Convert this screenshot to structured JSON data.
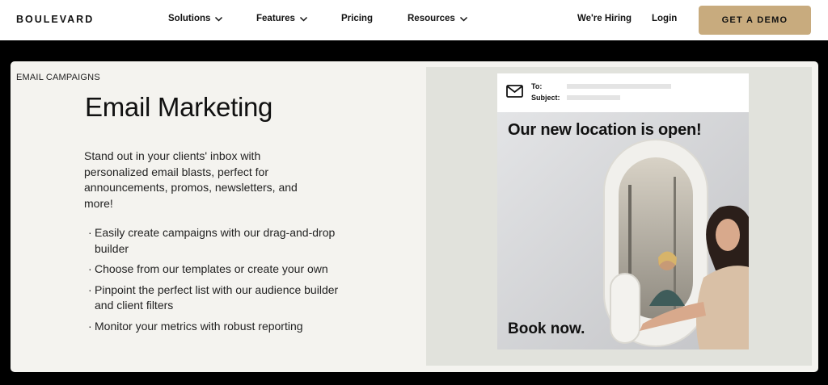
{
  "nav": {
    "logo": "BOULEVARD",
    "items": [
      {
        "label": "Solutions",
        "dropdown": true
      },
      {
        "label": "Features",
        "dropdown": true
      },
      {
        "label": "Pricing",
        "dropdown": false
      },
      {
        "label": "Resources",
        "dropdown": true
      }
    ],
    "hiring": "We're Hiring",
    "login": "Login",
    "demo_button": "GET A DEMO"
  },
  "section": {
    "eyebrow": "EMAIL CAMPAIGNS",
    "title": "Email Marketing",
    "description": "Stand out in your clients' inbox with personalized email blasts, perfect for announcements, promos, newsletters, and more!",
    "bullets": [
      "Easily create campaigns with our drag-and-drop builder",
      "Choose from our templates or create your own",
      "Pinpoint the perfect list with our audience builder and client filters",
      "Monitor your metrics with robust reporting"
    ]
  },
  "email_preview": {
    "to_label": "To:",
    "subject_label": "Subject:",
    "headline": "Our new location is open!",
    "cta": "Book now."
  },
  "colors": {
    "nav_bg": "#ffffff",
    "page_bg": "#000000",
    "card_bg": "#f4f3ef",
    "accent_button": "#c8ab7e",
    "preview_panel": "#e1e2dc"
  },
  "icons": {
    "chevron": "chevron-down-icon",
    "envelope": "envelope-icon"
  }
}
